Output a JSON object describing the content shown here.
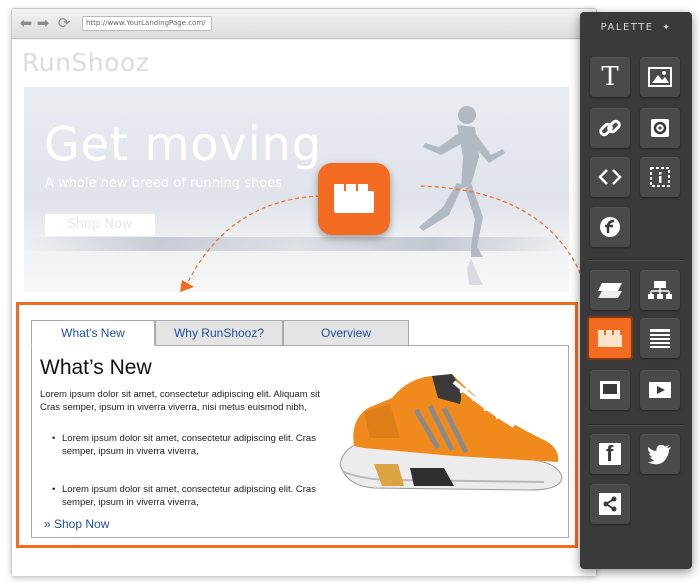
{
  "browser": {
    "url": "http://www.YourLandingPage.com/",
    "back_glyph": "⬅",
    "forward_glyph": "➡",
    "reload_glyph": "⟳"
  },
  "site": {
    "logo": "RunShooz",
    "hero": {
      "title": "Get moving",
      "subtitle": "A whole new breed of running shoes",
      "button": "Shop Now"
    }
  },
  "tabs_widget": {
    "tabs": [
      "What's New",
      "Why  RunShooz?",
      "Overview"
    ],
    "active_tab": "What's New",
    "panel_title": "What’s New",
    "paragraph": "Lorem ipsum dolor sit amet, consectetur adipiscing elit. Aliquam sit Cras semper, ipsum in viverra viverra, nisi metus euismod nibh,",
    "bullets": [
      "Lorem ipsum dolor sit amet, consectetur adipiscing elit. Cras semper, ipsum in viverra viverra,",
      "Lorem ipsum dolor sit amet, consectetur adipiscing elit. Cras semper, ipsum in viverra viverra,"
    ],
    "link": "» Shop Now"
  },
  "palette": {
    "title": "PALETTE",
    "pin_glyph": "✦",
    "items": [
      {
        "name": "text-icon",
        "glyph": "T"
      },
      {
        "name": "image-icon"
      },
      {
        "name": "link-icon"
      },
      {
        "name": "gear-icon"
      },
      {
        "name": "code-icon"
      },
      {
        "name": "dotted-frame-icon"
      },
      {
        "name": "flash-icon"
      },
      {
        "name": "layers-icon"
      },
      {
        "name": "sitemap-icon"
      },
      {
        "name": "tabs-icon",
        "active": true
      },
      {
        "name": "text-lines-icon"
      },
      {
        "name": "window-icon"
      },
      {
        "name": "video-play-icon"
      },
      {
        "name": "facebook-icon",
        "glyph": "f"
      },
      {
        "name": "twitter-icon"
      },
      {
        "name": "share-icon"
      }
    ]
  },
  "colors": {
    "accent": "#f26b21",
    "palette_bg": "#3a3a3a",
    "link": "#1f4fa3"
  }
}
